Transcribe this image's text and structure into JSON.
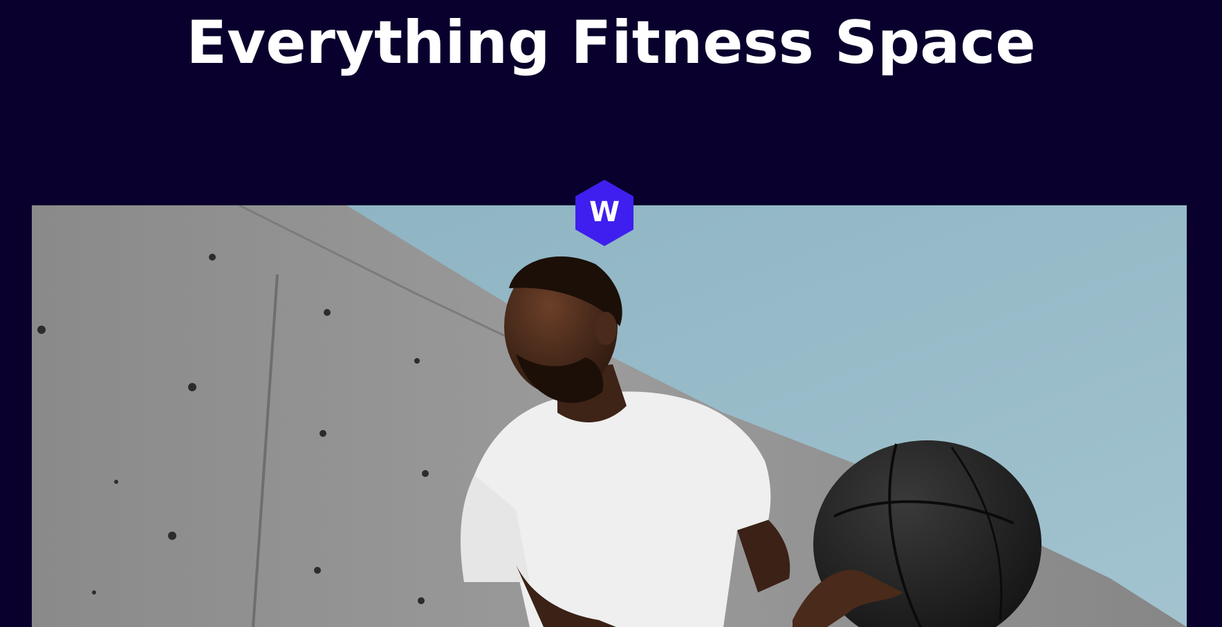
{
  "hero": {
    "title": "Everything Fitness Space"
  },
  "logo": {
    "letter": "W",
    "icon": "hexagon-logo-icon",
    "color": "#3e1fef"
  },
  "colors": {
    "background": "#09002d",
    "title": "#ffffff",
    "accent": "#3e1fef"
  }
}
